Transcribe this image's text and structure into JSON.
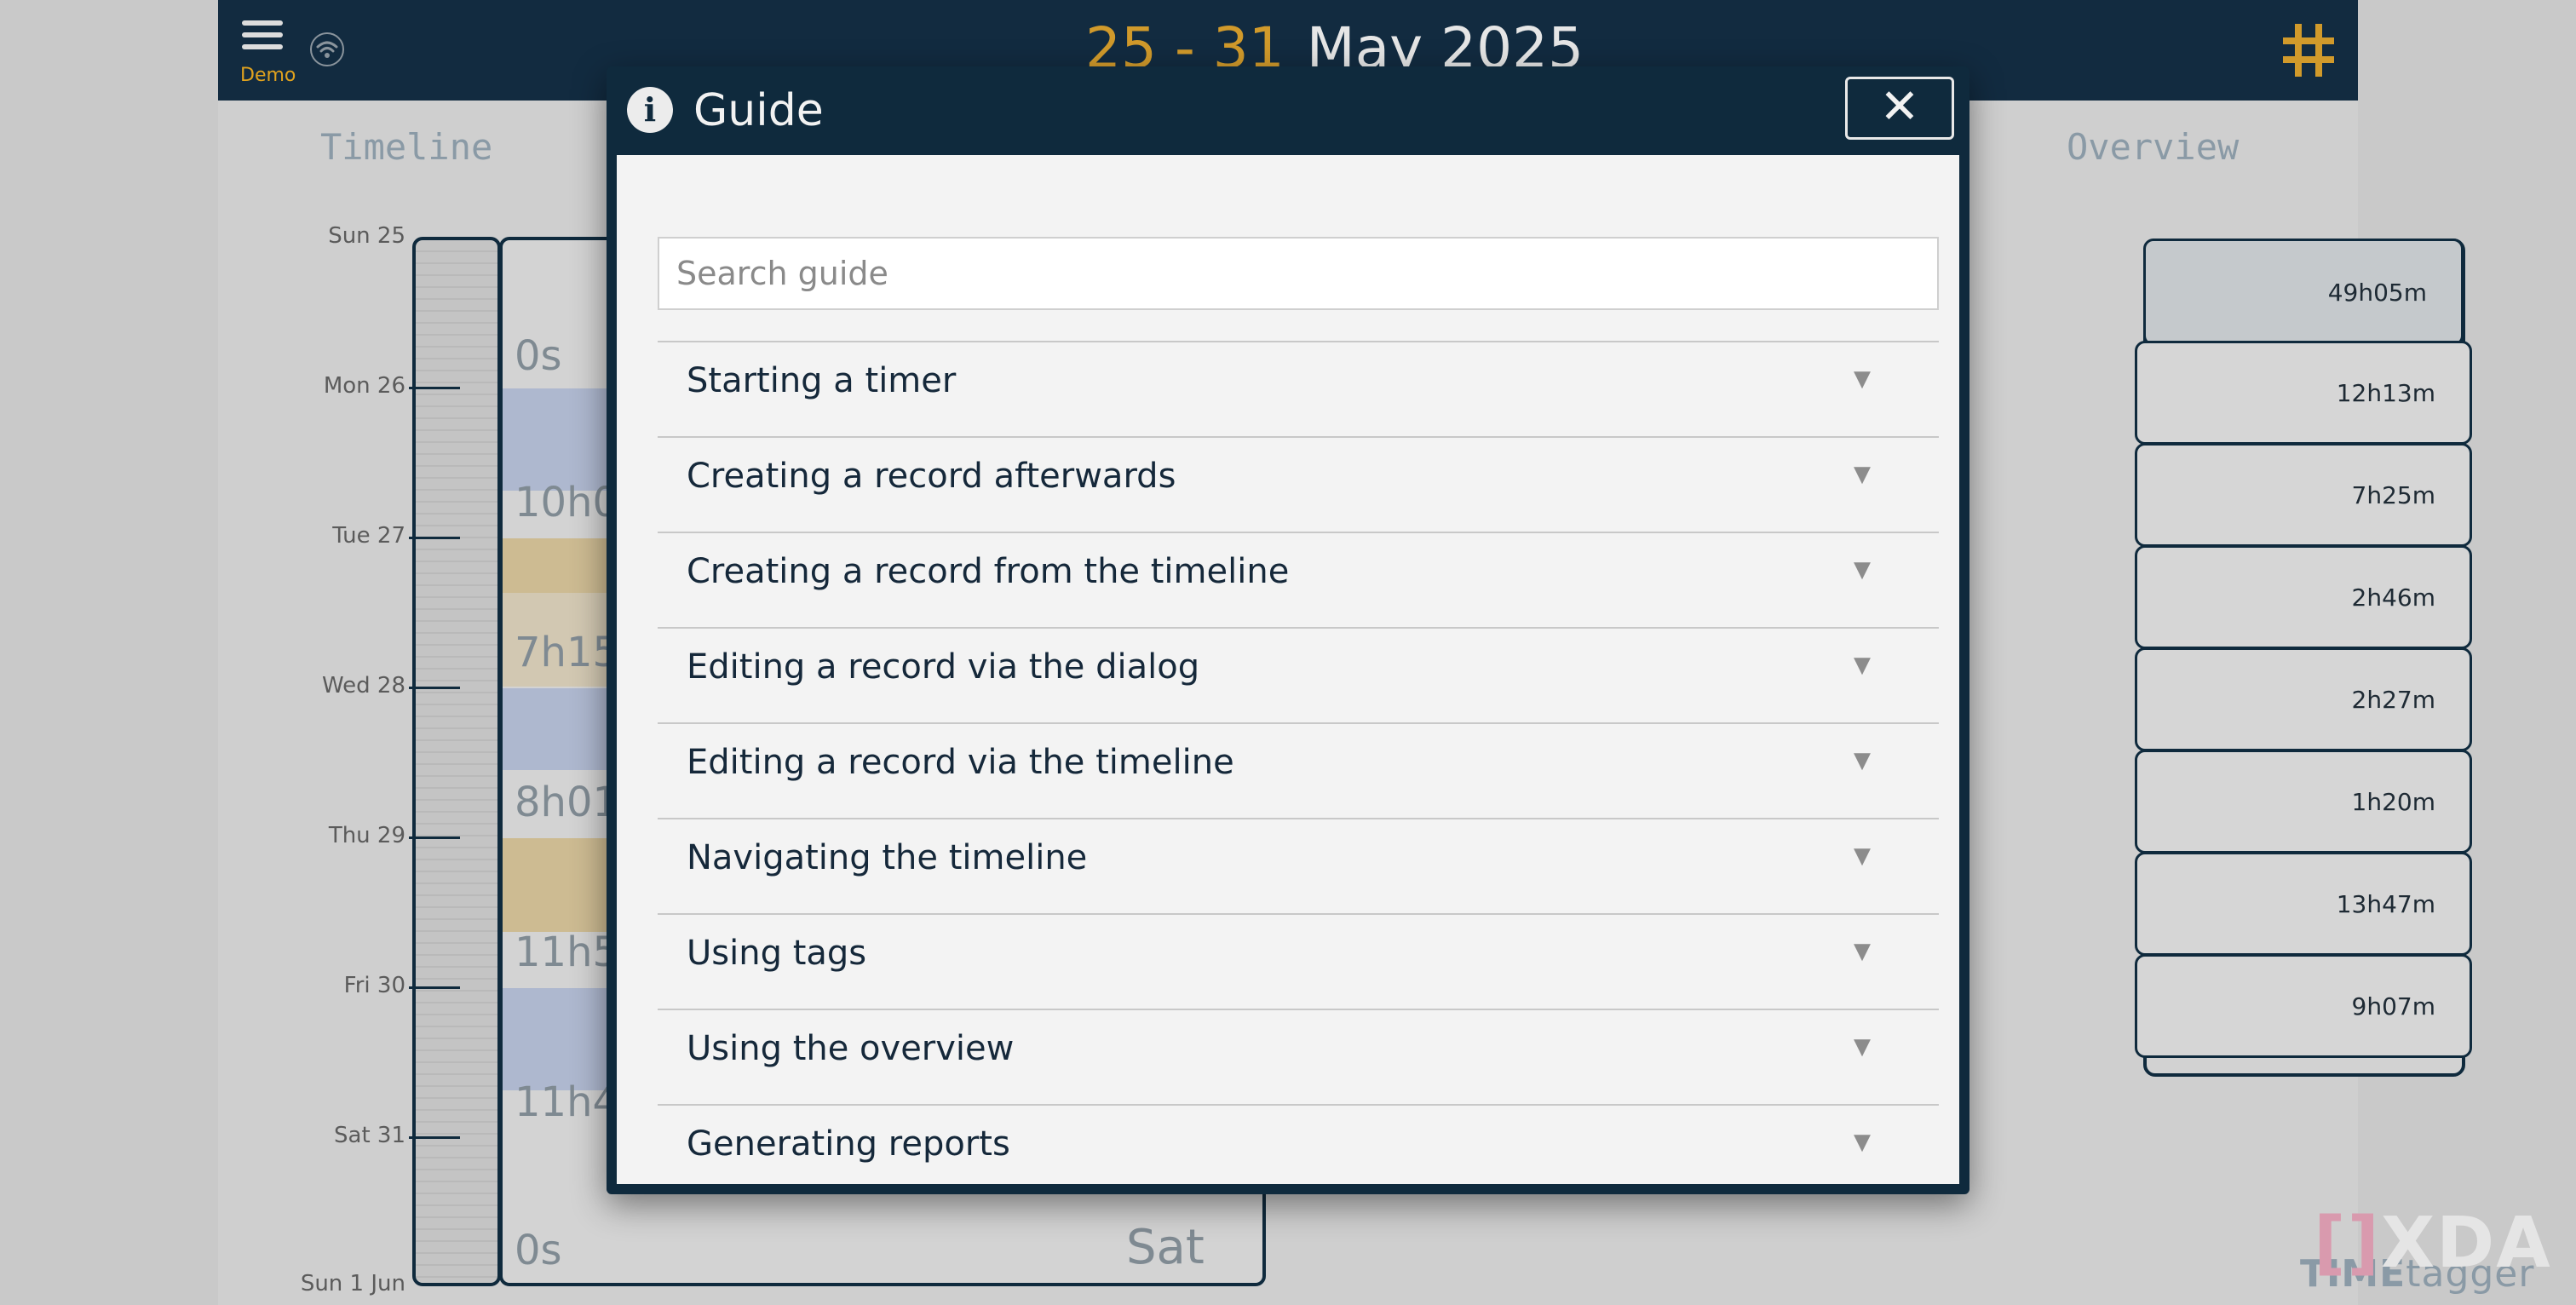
{
  "header": {
    "account": "Demo",
    "period_range": "25 - 31",
    "period_month": "May 2025"
  },
  "timeline": {
    "title": "Timeline",
    "days": [
      "Sun 25",
      "Mon 26",
      "Tue 27",
      "Wed 28",
      "Thu 29",
      "Fri 30",
      "Sat 31",
      "Sun 1 Jun"
    ],
    "durations": [
      "0s",
      "10h0",
      "7h15",
      "8h01",
      "11h5",
      "11h4",
      "0s"
    ],
    "end_label": "Sat"
  },
  "overview": {
    "title": "Overview",
    "values": [
      "49h05m",
      "12h13m",
      "7h25m",
      "2h46m",
      "2h27m",
      "1h20m",
      "13h47m",
      "9h07m"
    ]
  },
  "modal": {
    "title": "Guide",
    "close_label": "✕",
    "search_placeholder": "Search guide",
    "items": [
      "Starting a timer",
      "Creating a record afterwards",
      "Creating a record from the timeline",
      "Editing a record via the dialog",
      "Editing a record via the timeline",
      "Navigating the timeline",
      "Using tags",
      "Using the overview",
      "Generating reports"
    ]
  },
  "branding": {
    "app_time": "TIME",
    "app_tagger": "tagger",
    "watermark": "XDA"
  },
  "colors": {
    "topbar": "#122b40",
    "accent": "#d19a2b",
    "modal_body": "#f3f3f3"
  }
}
